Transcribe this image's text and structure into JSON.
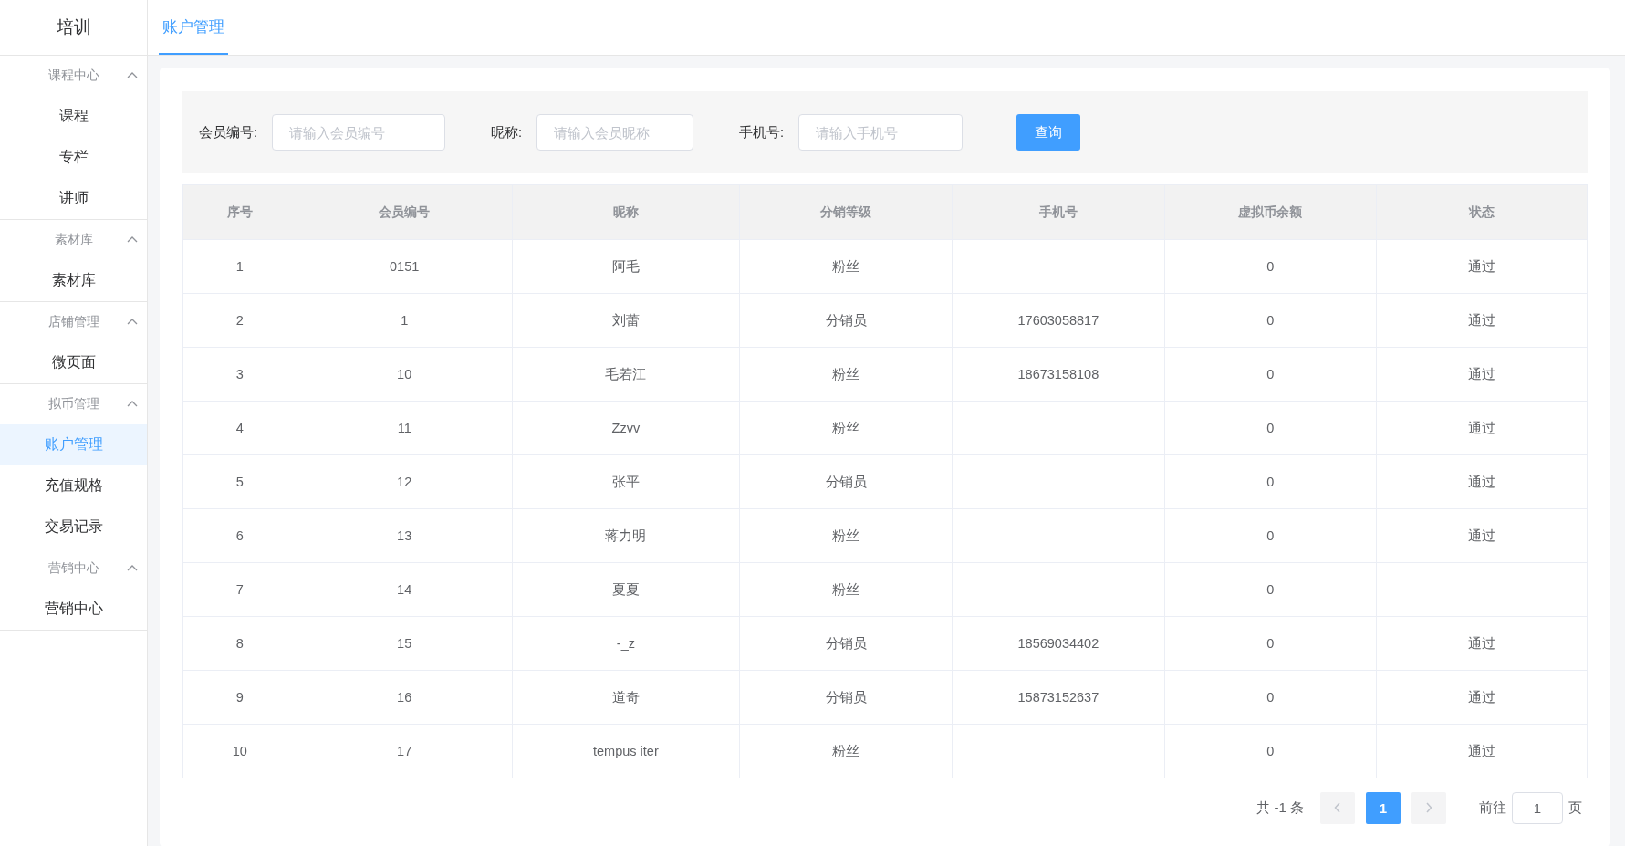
{
  "sidebar": {
    "title": "培训",
    "groups": [
      {
        "label": "课程中心",
        "expanded": true,
        "items": [
          {
            "label": "课程",
            "selected": false
          },
          {
            "label": "专栏",
            "selected": false
          },
          {
            "label": "讲师",
            "selected": false
          }
        ]
      },
      {
        "label": "素材库",
        "expanded": true,
        "items": [
          {
            "label": "素材库",
            "selected": false
          }
        ]
      },
      {
        "label": "店铺管理",
        "expanded": true,
        "items": [
          {
            "label": "微页面",
            "selected": false
          }
        ]
      },
      {
        "label": "拟币管理",
        "expanded": true,
        "items": [
          {
            "label": "账户管理",
            "selected": true
          },
          {
            "label": "充值规格",
            "selected": false
          },
          {
            "label": "交易记录",
            "selected": false
          }
        ]
      },
      {
        "label": "营销中心",
        "expanded": true,
        "items": [
          {
            "label": "营销中心",
            "selected": false
          }
        ]
      }
    ]
  },
  "tabs": [
    {
      "label": "账户管理",
      "selected": true
    }
  ],
  "filters": [
    {
      "label": "会员编号:",
      "placeholder": "请输入会员编号"
    },
    {
      "label": "昵称:",
      "placeholder": "请输入会员昵称"
    },
    {
      "label": "手机号:",
      "placeholder": "请输入手机号"
    }
  ],
  "search_button": "查询",
  "table": {
    "columns": [
      "序号",
      "会员编号",
      "昵称",
      "分销等级",
      "手机号",
      "虚拟币余额",
      "状态"
    ],
    "rows": [
      {
        "index": "1",
        "member_id": "0151",
        "nickname": "阿毛",
        "level": "粉丝",
        "balance": "0",
        "status": "通过"
      },
      {
        "index": "2",
        "member_id": "1",
        "nickname": "刘蕾",
        "level": "分销员",
        "phone": "17603058817",
        "balance": "0",
        "status": "通过"
      },
      {
        "index": "3",
        "member_id": "10",
        "nickname": "毛若江",
        "level": "粉丝",
        "phone": "18673158108",
        "balance": "0",
        "status": "通过"
      },
      {
        "index": "4",
        "member_id": "11",
        "nickname": "Zzvv",
        "level": "粉丝",
        "balance": "0",
        "status": "通过"
      },
      {
        "index": "5",
        "member_id": "12",
        "nickname": "张平",
        "level": "分销员",
        "balance": "0",
        "status": "通过"
      },
      {
        "index": "6",
        "member_id": "13",
        "nickname": "蒋力明",
        "level": "粉丝",
        "balance": "0",
        "status": "通过"
      },
      {
        "index": "7",
        "member_id": "14",
        "nickname": "夏夏",
        "level": "粉丝",
        "balance": "0"
      },
      {
        "index": "8",
        "member_id": "15",
        "nickname": "-_z",
        "level": "分销员",
        "phone": "18569034402",
        "balance": "0",
        "status": "通过"
      },
      {
        "index": "9",
        "member_id": "16",
        "nickname": "道奇",
        "level": "分销员",
        "phone": "15873152637",
        "balance": "0",
        "status": "通过"
      },
      {
        "index": "10",
        "member_id": "17",
        "nickname": "tempus iter",
        "level": "粉丝",
        "balance": "0",
        "status": "通过"
      }
    ]
  },
  "pagination": {
    "total": "共 -1 条",
    "pages": [
      {
        "label": "1",
        "selected": true
      }
    ],
    "goto_label": "前往",
    "goto_value": "1",
    "goto_suffix": "页"
  }
}
